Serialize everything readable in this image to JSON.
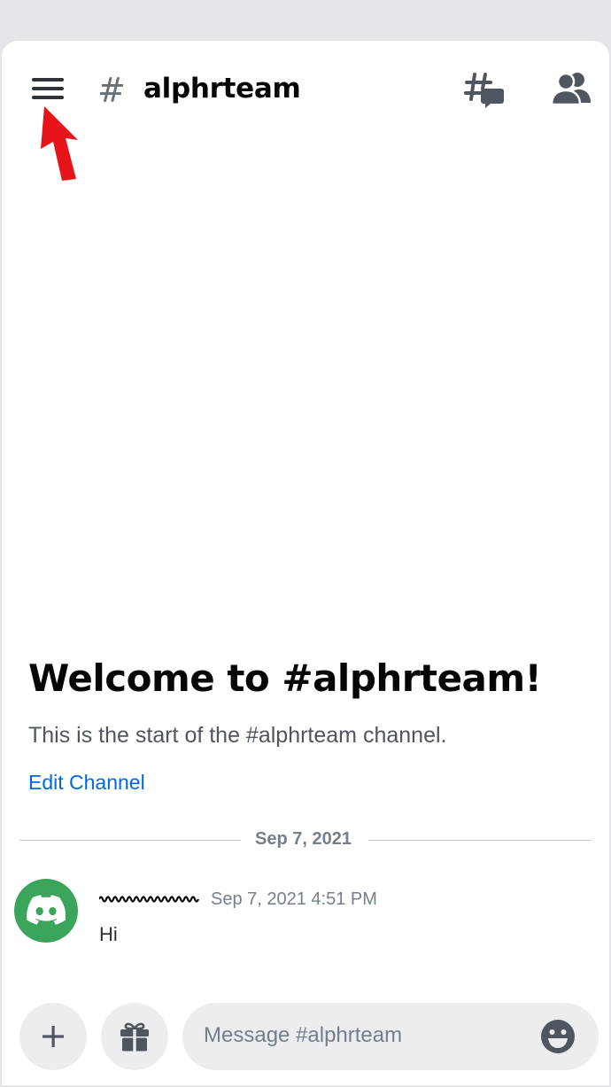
{
  "header": {
    "hash_symbol": "#",
    "channel_name": "alphrteam"
  },
  "welcome": {
    "title": "Welcome to #alphrteam!",
    "subtitle": "This is the start of the #alphrteam channel.",
    "edit_channel": "Edit Channel"
  },
  "divider": {
    "date": "Sep 7, 2021"
  },
  "message": {
    "timestamp": "Sep 7, 2021 4:51 PM",
    "text": "Hi"
  },
  "composer": {
    "placeholder": "Message #alphrteam"
  },
  "icons": {
    "menu": "hamburger-menu-icon",
    "threads": "threads-icon",
    "members": "members-icon",
    "annotation": "red-arrow-annotation",
    "avatar": "discord-logo-icon",
    "attach": "plus-icon",
    "gift": "gift-icon",
    "emoji": "emoji-icon"
  },
  "colors": {
    "accent_link": "#0068e0",
    "avatar_bg": "#3ba55c",
    "annotation_arrow": "#e8141c"
  }
}
